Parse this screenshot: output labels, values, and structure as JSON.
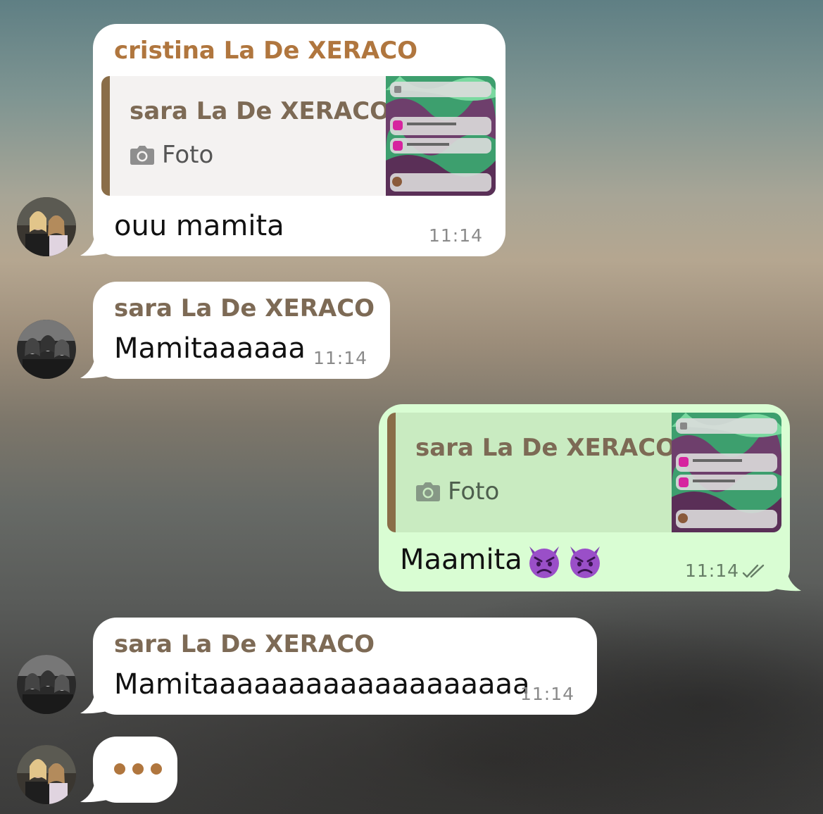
{
  "colors": {
    "incoming_bubble": "#ffffff",
    "outgoing_bubble": "#d9fdd3",
    "sender_cristina": "#b0763e",
    "sender_sara": "#7d6a55",
    "quote_bar": "#8a6d48",
    "typing_dots": "#b0763e"
  },
  "messages": [
    {
      "direction": "incoming",
      "sender": "cristina La De XERACO",
      "reply_to": {
        "name": "sara La De XERACO",
        "type_icon": "camera-icon",
        "type_label": "Foto"
      },
      "text": "ouu mamita",
      "time": "11:14",
      "avatar": "avatar-cristina"
    },
    {
      "direction": "incoming",
      "sender": "sara La De XERACO",
      "text": "Mamitaaaaaa",
      "time": "11:14",
      "avatar": "avatar-sara"
    },
    {
      "direction": "outgoing",
      "reply_to": {
        "name": "sara La De XERACO",
        "type_icon": "camera-icon",
        "type_label": "Foto"
      },
      "text": "Maamita",
      "emojis": [
        "angry-devil-emoji",
        "angry-devil-emoji"
      ],
      "time": "11:14",
      "status_icon": "double-check-icon"
    },
    {
      "direction": "incoming",
      "sender": "sara La De XERACO",
      "text": "Mamitaaaaaaaaaaaaaaaaaaa",
      "time": "11:14",
      "avatar": "avatar-sara"
    },
    {
      "direction": "incoming",
      "typing": true,
      "avatar": "avatar-cristina"
    }
  ]
}
